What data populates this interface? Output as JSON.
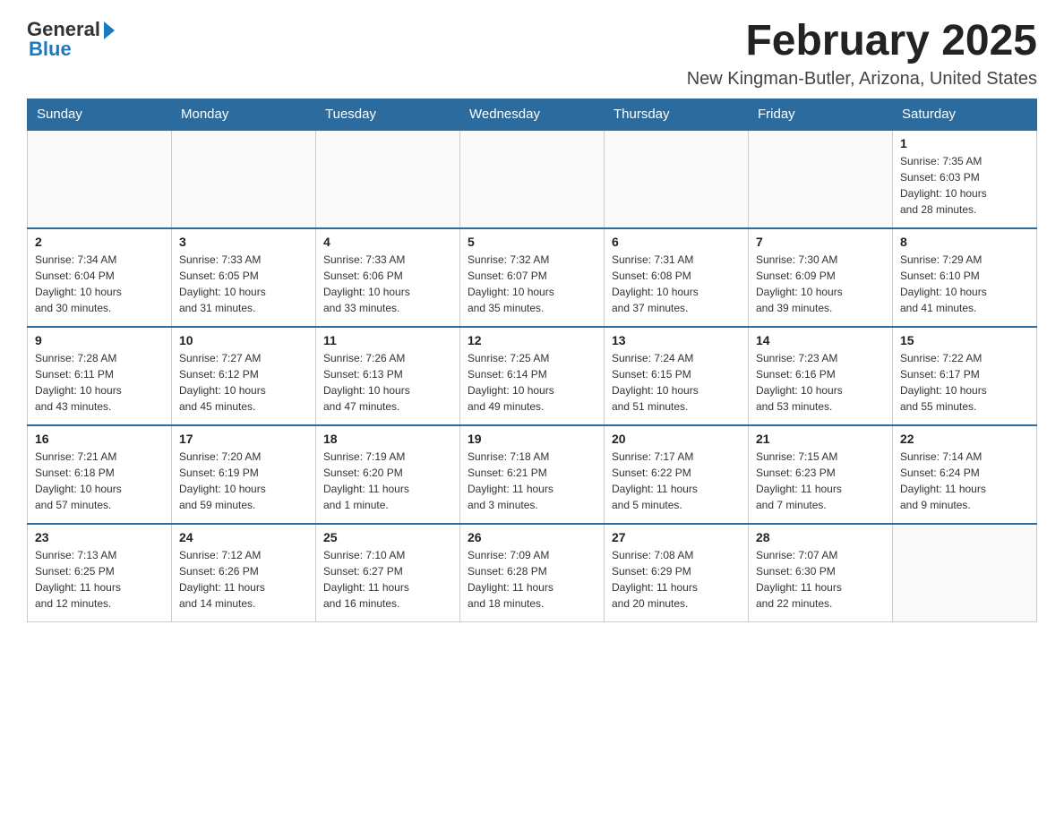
{
  "logo": {
    "general": "General",
    "blue": "Blue"
  },
  "title": "February 2025",
  "subtitle": "New Kingman-Butler, Arizona, United States",
  "days_of_week": [
    "Sunday",
    "Monday",
    "Tuesday",
    "Wednesday",
    "Thursday",
    "Friday",
    "Saturday"
  ],
  "weeks": [
    [
      {
        "day": "",
        "info": ""
      },
      {
        "day": "",
        "info": ""
      },
      {
        "day": "",
        "info": ""
      },
      {
        "day": "",
        "info": ""
      },
      {
        "day": "",
        "info": ""
      },
      {
        "day": "",
        "info": ""
      },
      {
        "day": "1",
        "info": "Sunrise: 7:35 AM\nSunset: 6:03 PM\nDaylight: 10 hours\nand 28 minutes."
      }
    ],
    [
      {
        "day": "2",
        "info": "Sunrise: 7:34 AM\nSunset: 6:04 PM\nDaylight: 10 hours\nand 30 minutes."
      },
      {
        "day": "3",
        "info": "Sunrise: 7:33 AM\nSunset: 6:05 PM\nDaylight: 10 hours\nand 31 minutes."
      },
      {
        "day": "4",
        "info": "Sunrise: 7:33 AM\nSunset: 6:06 PM\nDaylight: 10 hours\nand 33 minutes."
      },
      {
        "day": "5",
        "info": "Sunrise: 7:32 AM\nSunset: 6:07 PM\nDaylight: 10 hours\nand 35 minutes."
      },
      {
        "day": "6",
        "info": "Sunrise: 7:31 AM\nSunset: 6:08 PM\nDaylight: 10 hours\nand 37 minutes."
      },
      {
        "day": "7",
        "info": "Sunrise: 7:30 AM\nSunset: 6:09 PM\nDaylight: 10 hours\nand 39 minutes."
      },
      {
        "day": "8",
        "info": "Sunrise: 7:29 AM\nSunset: 6:10 PM\nDaylight: 10 hours\nand 41 minutes."
      }
    ],
    [
      {
        "day": "9",
        "info": "Sunrise: 7:28 AM\nSunset: 6:11 PM\nDaylight: 10 hours\nand 43 minutes."
      },
      {
        "day": "10",
        "info": "Sunrise: 7:27 AM\nSunset: 6:12 PM\nDaylight: 10 hours\nand 45 minutes."
      },
      {
        "day": "11",
        "info": "Sunrise: 7:26 AM\nSunset: 6:13 PM\nDaylight: 10 hours\nand 47 minutes."
      },
      {
        "day": "12",
        "info": "Sunrise: 7:25 AM\nSunset: 6:14 PM\nDaylight: 10 hours\nand 49 minutes."
      },
      {
        "day": "13",
        "info": "Sunrise: 7:24 AM\nSunset: 6:15 PM\nDaylight: 10 hours\nand 51 minutes."
      },
      {
        "day": "14",
        "info": "Sunrise: 7:23 AM\nSunset: 6:16 PM\nDaylight: 10 hours\nand 53 minutes."
      },
      {
        "day": "15",
        "info": "Sunrise: 7:22 AM\nSunset: 6:17 PM\nDaylight: 10 hours\nand 55 minutes."
      }
    ],
    [
      {
        "day": "16",
        "info": "Sunrise: 7:21 AM\nSunset: 6:18 PM\nDaylight: 10 hours\nand 57 minutes."
      },
      {
        "day": "17",
        "info": "Sunrise: 7:20 AM\nSunset: 6:19 PM\nDaylight: 10 hours\nand 59 minutes."
      },
      {
        "day": "18",
        "info": "Sunrise: 7:19 AM\nSunset: 6:20 PM\nDaylight: 11 hours\nand 1 minute."
      },
      {
        "day": "19",
        "info": "Sunrise: 7:18 AM\nSunset: 6:21 PM\nDaylight: 11 hours\nand 3 minutes."
      },
      {
        "day": "20",
        "info": "Sunrise: 7:17 AM\nSunset: 6:22 PM\nDaylight: 11 hours\nand 5 minutes."
      },
      {
        "day": "21",
        "info": "Sunrise: 7:15 AM\nSunset: 6:23 PM\nDaylight: 11 hours\nand 7 minutes."
      },
      {
        "day": "22",
        "info": "Sunrise: 7:14 AM\nSunset: 6:24 PM\nDaylight: 11 hours\nand 9 minutes."
      }
    ],
    [
      {
        "day": "23",
        "info": "Sunrise: 7:13 AM\nSunset: 6:25 PM\nDaylight: 11 hours\nand 12 minutes."
      },
      {
        "day": "24",
        "info": "Sunrise: 7:12 AM\nSunset: 6:26 PM\nDaylight: 11 hours\nand 14 minutes."
      },
      {
        "day": "25",
        "info": "Sunrise: 7:10 AM\nSunset: 6:27 PM\nDaylight: 11 hours\nand 16 minutes."
      },
      {
        "day": "26",
        "info": "Sunrise: 7:09 AM\nSunset: 6:28 PM\nDaylight: 11 hours\nand 18 minutes."
      },
      {
        "day": "27",
        "info": "Sunrise: 7:08 AM\nSunset: 6:29 PM\nDaylight: 11 hours\nand 20 minutes."
      },
      {
        "day": "28",
        "info": "Sunrise: 7:07 AM\nSunset: 6:30 PM\nDaylight: 11 hours\nand 22 minutes."
      },
      {
        "day": "",
        "info": ""
      }
    ]
  ]
}
